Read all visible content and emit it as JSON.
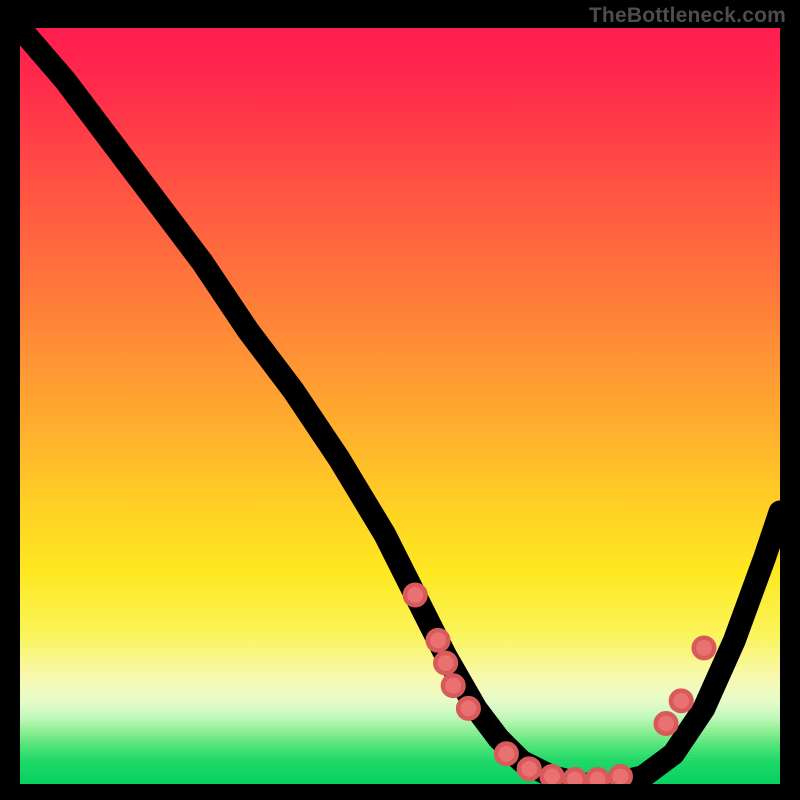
{
  "watermark": "TheBottleneck.com",
  "chart_data": {
    "type": "line",
    "title": "",
    "xlabel": "",
    "ylabel": "",
    "xlim": [
      0,
      100
    ],
    "ylim": [
      0,
      100
    ],
    "grid": false,
    "legend": false,
    "background": "red-yellow-green-vertical-gradient",
    "series": [
      {
        "name": "bottleneck-curve",
        "x": [
          0,
          6,
          12,
          18,
          24,
          30,
          36,
          42,
          48,
          52,
          56,
          60,
          63,
          66,
          70,
          74,
          78,
          82,
          86,
          90,
          94,
          98,
          100
        ],
        "y": [
          100,
          93,
          85,
          77,
          69,
          60,
          52,
          43,
          33,
          25,
          17,
          10,
          6,
          3,
          1,
          0,
          0,
          1,
          4,
          10,
          19,
          30,
          36
        ]
      }
    ],
    "markers": [
      {
        "x": 52,
        "y": 25
      },
      {
        "x": 55,
        "y": 19
      },
      {
        "x": 56,
        "y": 16
      },
      {
        "x": 57,
        "y": 13
      },
      {
        "x": 59,
        "y": 10
      },
      {
        "x": 64,
        "y": 4
      },
      {
        "x": 67,
        "y": 2
      },
      {
        "x": 70,
        "y": 1
      },
      {
        "x": 73,
        "y": 0.6
      },
      {
        "x": 76,
        "y": 0.6
      },
      {
        "x": 79,
        "y": 1
      },
      {
        "x": 85,
        "y": 8
      },
      {
        "x": 87,
        "y": 11
      },
      {
        "x": 90,
        "y": 18
      }
    ],
    "marker_color": "#e97171",
    "curve_color": "#000000"
  }
}
